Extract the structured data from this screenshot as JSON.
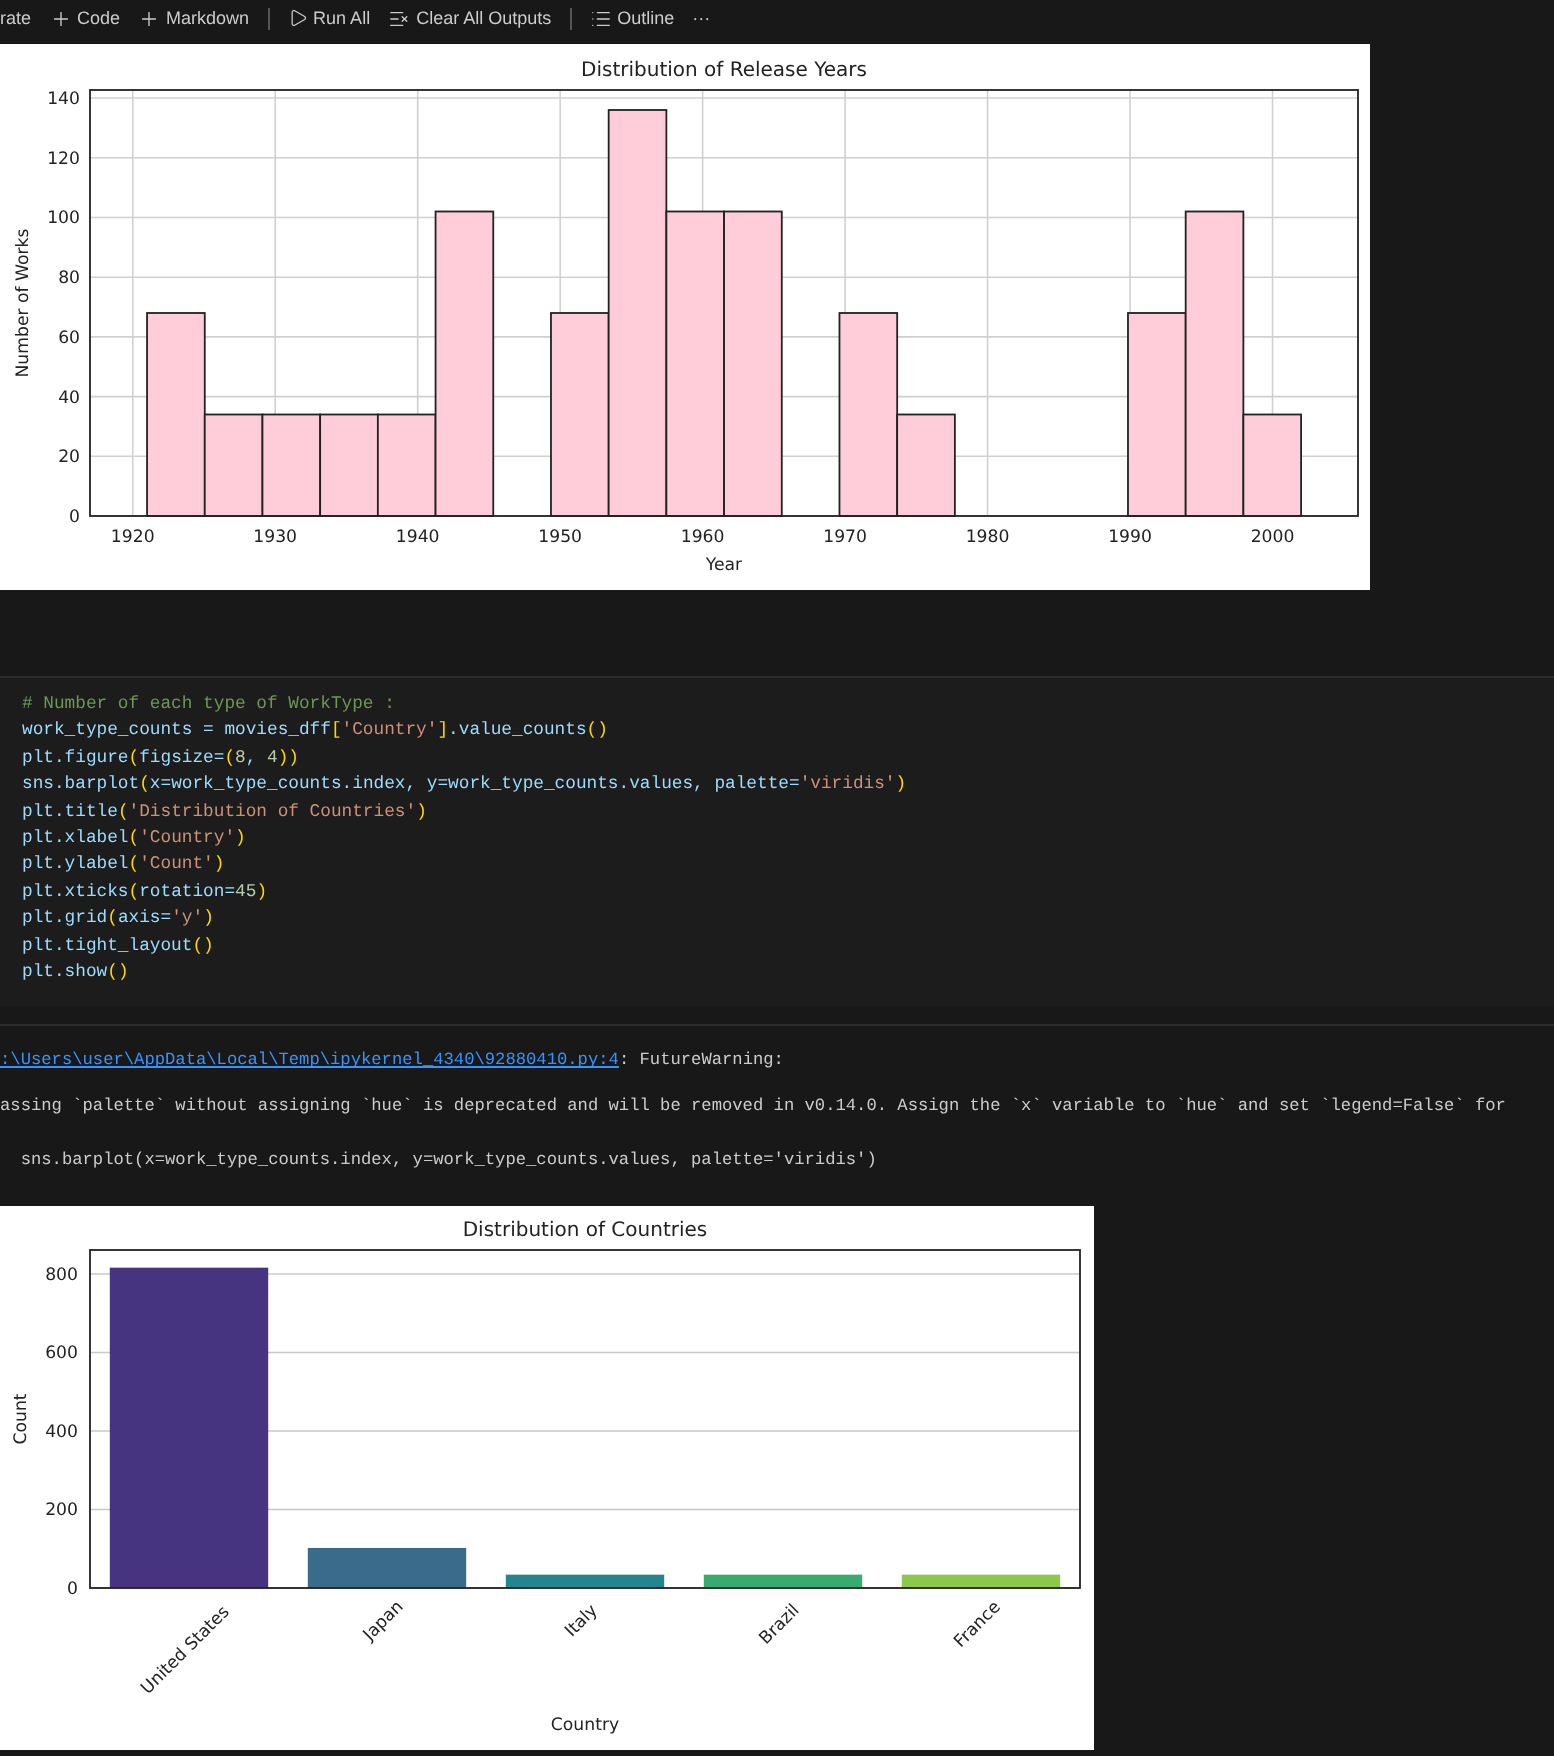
{
  "toolbar": {
    "items": [
      {
        "kind": "text",
        "label": "rate",
        "divider_before": false
      },
      {
        "kind": "add",
        "label": "Code",
        "divider_before": false
      },
      {
        "kind": "add",
        "label": "Markdown",
        "divider_before": false
      },
      {
        "kind": "run",
        "label": "Run All",
        "divider_before": true
      },
      {
        "kind": "clear",
        "label": "Clear All Outputs",
        "divider_before": false
      },
      {
        "kind": "outline",
        "label": "Outline",
        "divider_before": true
      },
      {
        "kind": "more",
        "label": "···",
        "divider_before": false
      }
    ]
  },
  "histogram_output": {
    "chart_data": {
      "type": "bar",
      "title": "Distribution of Release Years",
      "xlabel": "Year",
      "ylabel": "Number of Works",
      "grid": "both",
      "x": [
        1923.03,
        1927.08,
        1931.13,
        1935.18,
        1939.23,
        1943.28,
        1947.33,
        1951.38,
        1955.43,
        1959.48,
        1963.53,
        1967.58,
        1971.63,
        1975.68,
        1979.73,
        1983.78,
        1987.83,
        1991.88,
        1995.93,
        1999.98
      ],
      "values": [
        68,
        34,
        34,
        34,
        34,
        102,
        0,
        68,
        136,
        102,
        102,
        0,
        68,
        34,
        0,
        0,
        0,
        68,
        102,
        34
      ],
      "xlim": [
        1917,
        2006
      ],
      "ylim": [
        0,
        142.7
      ],
      "xticks": [
        1920,
        1930,
        1940,
        1950,
        1960,
        1970,
        1980,
        1990,
        2000
      ],
      "yticks": [
        0,
        20,
        40,
        60,
        80,
        100,
        120,
        140
      ]
    }
  },
  "code_cell": {
    "lines": [
      "# Number of each type of WorkType :",
      "work_type_counts = movies_dff['Country'].value_counts()",
      "plt.figure(figsize=(8, 4))",
      "sns.barplot(x=work_type_counts.index, y=work_type_counts.values, palette='viridis')",
      "plt.title('Distribution of Countries')",
      "plt.xlabel('Country')",
      "plt.ylabel('Count')",
      "plt.xticks(rotation=45)",
      "plt.grid(axis='y')",
      "plt.tight_layout()",
      "plt.show()"
    ]
  },
  "warning_output": {
    "file_link": ":\\Users\\user\\AppData\\Local\\Temp\\ipykernel_4340\\92880410.py:4",
    "warning_type": ": FutureWarning:",
    "message": "assing `palette` without assigning `hue` is deprecated and will be removed in v0.14.0. Assign the `x` variable to `hue` and set `legend=False` for",
    "source_line": "  sns.barplot(x=work_type_counts.index, y=work_type_counts.values, palette='viridis')"
  },
  "countries_output": {
    "chart_data": {
      "type": "bar",
      "title": "Distribution of Countries",
      "xlabel": "Country",
      "ylabel": "Count",
      "categories": [
        "United States",
        "Japan",
        "Italy",
        "Brazil",
        "France"
      ],
      "grid": "y",
      "values": [
        816,
        102,
        34,
        34,
        34
      ],
      "colors": [
        "#463480",
        "#3a6b8b",
        "#25858e",
        "#3aab6f",
        "#8cc84c"
      ],
      "ylim": [
        0,
        861
      ],
      "yticks": [
        0,
        200,
        400,
        600,
        800
      ]
    }
  }
}
